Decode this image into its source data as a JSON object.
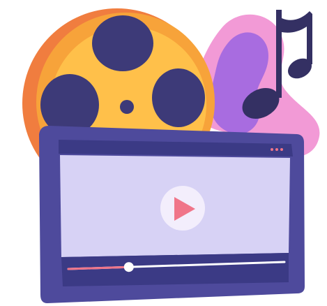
{
  "illustration": {
    "subject": "video-player-with-film-reel-and-music-note",
    "icons": [
      "film-reel-icon",
      "music-note-icon",
      "play-icon"
    ],
    "colors": {
      "reel_outer": "#f7a33a",
      "reel_shadow": "#f07d3f",
      "reel_inner": "#ffc04a",
      "reel_holes": "#3d3a78",
      "blob_pink": "#f29ad6",
      "blob_violet": "#a86ce0",
      "note": "#343063",
      "monitor_frame": "#4e4a9c",
      "monitor_bezel": "#3b3a85",
      "screen": "#d7d2f5",
      "play_circle": "#f3eefc",
      "play_triangle": "#f07589",
      "progress_filled": "#f07589",
      "progress_track": "#ffffff",
      "window_dots": "#f07589"
    },
    "video_progress": 0.28
  }
}
